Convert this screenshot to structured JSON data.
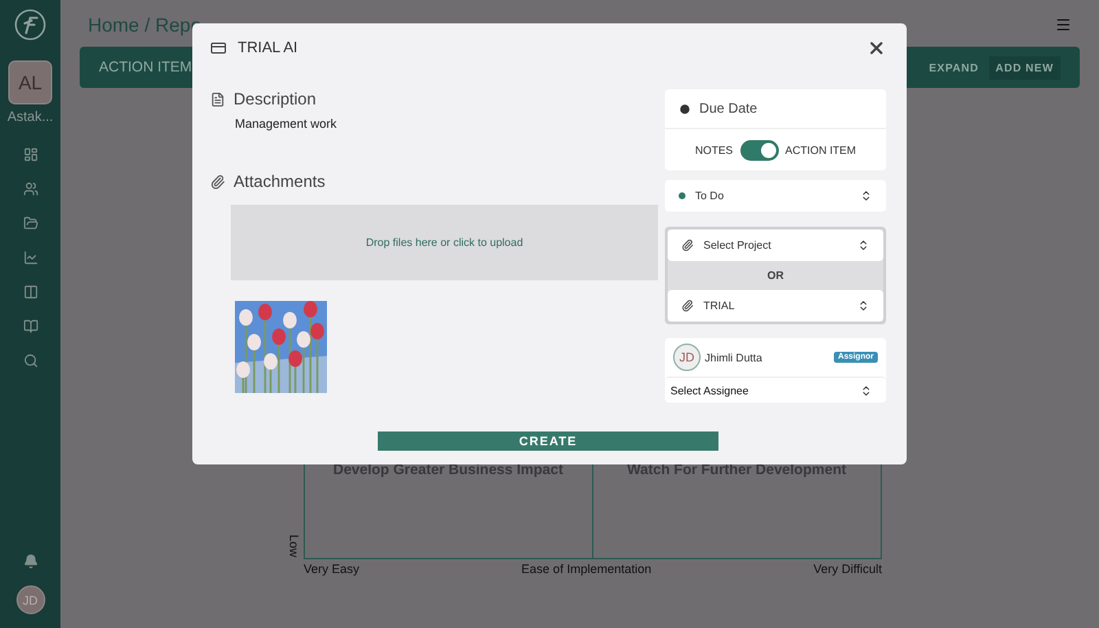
{
  "sidebar": {
    "avatar": {
      "initials": "AL",
      "label": "Astak..."
    },
    "user": {
      "initials": "JD"
    }
  },
  "header": {
    "breadcrumb": "Home / Repo",
    "toolbar": {
      "title": "ACTION ITEM",
      "buttons": [
        "EXPAND",
        "ADD NEW"
      ]
    }
  },
  "matrix": {
    "quadrant_labels": [
      "Develop Greater Business Impact",
      "Watch For Further Development"
    ],
    "y_label": "Low",
    "x_labels": [
      "Very Easy",
      "Ease of Implementation",
      "Very Difficult"
    ]
  },
  "modal": {
    "title": "TRIAL AI",
    "description": {
      "heading": "Description",
      "text": "Management work"
    },
    "attachments": {
      "heading": "Attachments",
      "dropzone": "Drop files here or click to upload"
    },
    "due_date": {
      "label": "Due Date"
    },
    "type_toggle": {
      "left": "NOTES",
      "right": "ACTION ITEM",
      "on": true
    },
    "status": {
      "value": "To Do",
      "color": "#2f7a68"
    },
    "project": {
      "select_label": "Select Project",
      "separator": "OR",
      "value": "TRIAL"
    },
    "assignor": {
      "initials": "JD",
      "name": "Jhimli Dutta",
      "badge": "Assignor"
    },
    "assignee": {
      "placeholder": "Select Assignee"
    },
    "submit": "CREATE"
  }
}
